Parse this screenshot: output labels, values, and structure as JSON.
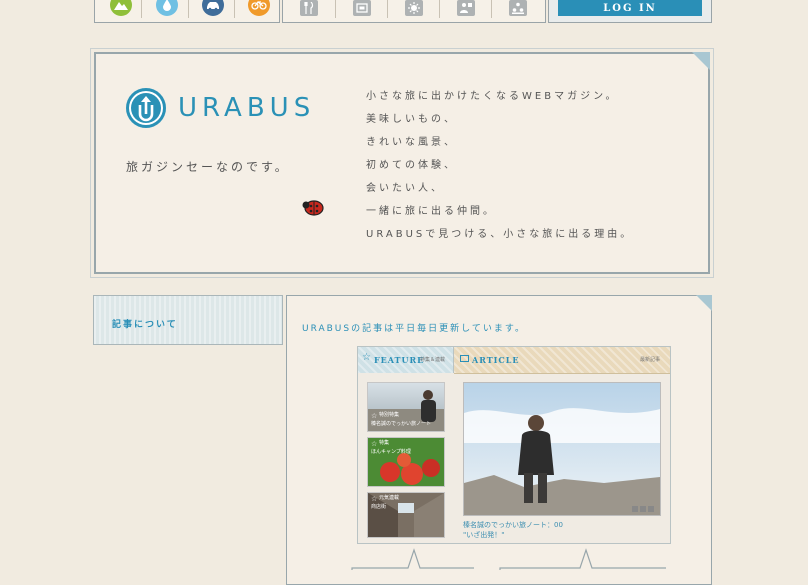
{
  "nav": {
    "category_icons": [
      {
        "name": "mountain-icon",
        "color": "#8fbf3a"
      },
      {
        "name": "water-drop-icon",
        "color": "#6fc0e3"
      },
      {
        "name": "car-icon",
        "color": "#3f6d9a"
      },
      {
        "name": "bicycle-icon",
        "color": "#f09a2a"
      }
    ],
    "genre_icons": [
      "restaurant-icon",
      "hotel-icon",
      "sightseeing-icon",
      "people-icon",
      "community-icon"
    ],
    "login_label": "LOG IN"
  },
  "hero": {
    "logo_text": "URABUS",
    "tagline": "旅ガジンセーなのです。",
    "copy_lines": [
      "小さな旅に出かけたくなるWEBマガジン。",
      "美味しいもの、",
      "きれいな風景、",
      "初めての体験、",
      "会いたい人、",
      "一緒に旅に出る仲間。",
      "URABUSで見つける、小さな旅に出る理由。"
    ]
  },
  "side": {
    "title": "記事について"
  },
  "main": {
    "title": "URABUSの記事は平日毎日更新しています。",
    "widget": {
      "feature_label": "FEATURE",
      "feature_sub": "特集＆連載",
      "article_label": "ARTICLE",
      "article_sub": "最新記事",
      "thumbs": [
        {
          "line1": "特別特集",
          "line2": "榛名誠のでっかい旅ノート"
        },
        {
          "line1": "特集",
          "line2": "ほんキャンプ料理"
        },
        {
          "line1": "元気連載",
          "line2": "商店街"
        }
      ],
      "caption_title": "榛名誠のでっかい旅ノート：00",
      "caption_sub": "\"いざ出発！\""
    }
  },
  "colors": {
    "accent": "#2a91b6",
    "border": "#98a6ab",
    "paper": "#f1ebe0"
  }
}
